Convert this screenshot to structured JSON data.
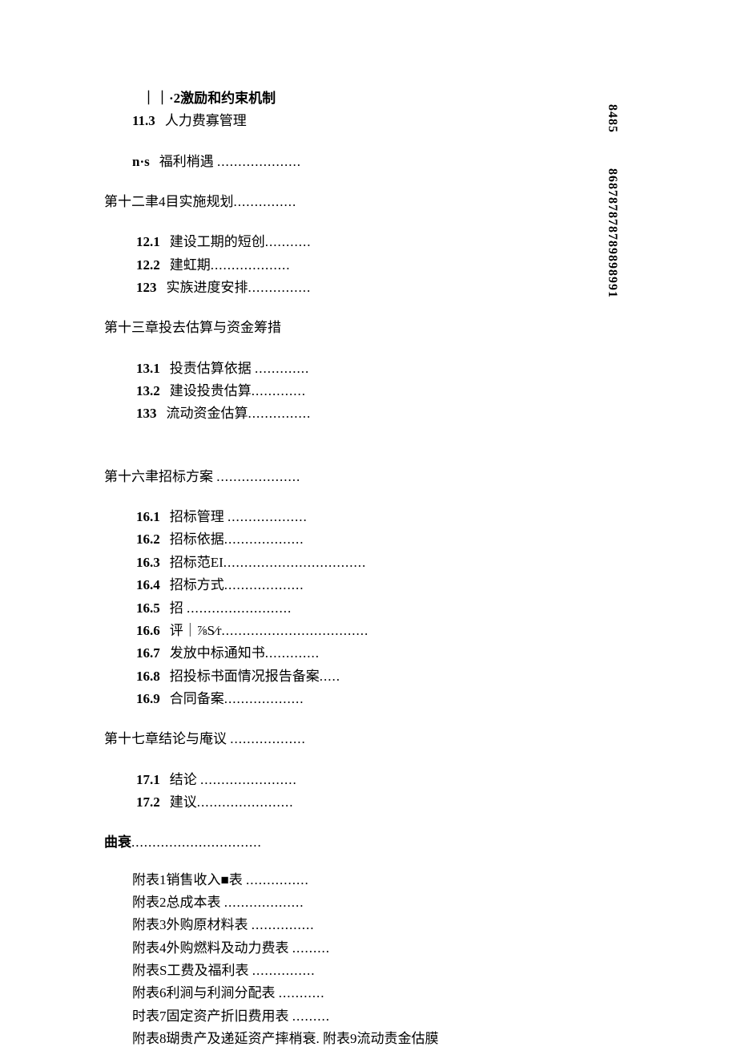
{
  "lines": [
    {
      "cls": "indent1 bold",
      "num": "",
      "label": "｜｜·2激励和约束机制",
      "dots": ""
    },
    {
      "cls": "indent1",
      "num": "11.3",
      "label": "人力费寡管理",
      "dots": ""
    },
    {
      "cls": "gap-md",
      "spacer": true
    },
    {
      "cls": "indent1",
      "num": "n·s",
      "label": "福利梢遇 ",
      "dots": "...................."
    },
    {
      "cls": "gap-md",
      "spacer": true
    },
    {
      "cls": "noNum",
      "num": "",
      "label": "第十二聿4目实施规划",
      "dots": "..............."
    },
    {
      "cls": "gap-md",
      "spacer": true
    },
    {
      "cls": "indent2",
      "num": "12.1",
      "label": "建设工期的短创",
      "dots": "..........."
    },
    {
      "cls": "indent2",
      "num": "12.2",
      "label": "建虹期",
      "dots": "..................."
    },
    {
      "cls": "indent2",
      "num": "123",
      "label": "实族进度安排",
      "dots": "..............."
    },
    {
      "cls": "gap-md",
      "spacer": true
    },
    {
      "cls": "noNum",
      "num": "",
      "label": "第十三章投去估算与资金筹措",
      "dots": ""
    },
    {
      "cls": "gap-md",
      "spacer": true
    },
    {
      "cls": "indent2",
      "num": "13.1",
      "label": "投责估算依据 ",
      "dots": "............."
    },
    {
      "cls": "indent2",
      "num": "13.2",
      "label": "建设投贵估算",
      "dots": "............."
    },
    {
      "cls": "indent2",
      "num": "133",
      "label": "流动资金估算",
      "dots": "..............."
    },
    {
      "cls": "gap-xl",
      "spacer": true
    },
    {
      "cls": "noNum",
      "num": "",
      "label": "第十六聿招标方案 ",
      "dots": "...................."
    },
    {
      "cls": "gap-md",
      "spacer": true
    },
    {
      "cls": "indent2",
      "num": "16.1",
      "label": "招标管理 ",
      "dots": "..................."
    },
    {
      "cls": "indent2",
      "num": "16.2",
      "label": "招标依据",
      "dots": "..................."
    },
    {
      "cls": "indent2",
      "num": "16.3",
      "label": "招标范EI",
      "dots": ".................................."
    },
    {
      "cls": "indent2",
      "num": "16.4",
      "label": "招标方式",
      "dots": "..................."
    },
    {
      "cls": "indent2",
      "num": "16.5",
      "label": "招 ",
      "dots": "........................."
    },
    {
      "cls": "indent2",
      "num": "16.6",
      "label": "评｜⅞S⁄r",
      "dots": "..................................."
    },
    {
      "cls": "indent2",
      "num": "16.7",
      "label": "发放中标通知书",
      "dots": "............."
    },
    {
      "cls": "indent2",
      "num": "16.8",
      "label": "招投标书面情况报告备案",
      "dots": "....."
    },
    {
      "cls": "indent2",
      "num": "16.9",
      "label": "合同备案",
      "dots": "..................."
    },
    {
      "cls": "gap-md",
      "spacer": true
    },
    {
      "cls": "noNum",
      "num": "",
      "label": "第十七章结论与庵议 ",
      "dots": ".................."
    },
    {
      "cls": "gap-md",
      "spacer": true
    },
    {
      "cls": "indent2",
      "num": "17.1",
      "label": "结论 ",
      "dots": "......................."
    },
    {
      "cls": "indent2",
      "num": "17.2",
      "label": "建议",
      "dots": "......................."
    },
    {
      "cls": "gap-md",
      "spacer": true
    },
    {
      "cls": "noNum bold",
      "num": "",
      "label": "曲衰",
      "dots": "..............................."
    },
    {
      "cls": "gap-sm",
      "spacer": true
    },
    {
      "cls": "indent1 noNum",
      "num": "",
      "label": "附表1销售收入■表 ",
      "dots": "..............."
    },
    {
      "cls": "indent1 noNum",
      "num": "",
      "label": "附表2总成本表 ",
      "dots": "..................."
    },
    {
      "cls": "indent1 noNum",
      "num": "",
      "label": "附表3外购原材料表 ",
      "dots": "..............."
    },
    {
      "cls": "indent1 noNum",
      "num": "",
      "label": "附表4外购燃料及动力费表 ",
      "dots": "........."
    },
    {
      "cls": "indent1 noNum",
      "num": "",
      "label": "附表S工费及福利表 ",
      "dots": "..............."
    },
    {
      "cls": "indent1 noNum",
      "num": "",
      "label": "附表6利涧与利涧分配表 ",
      "dots": "..........."
    },
    {
      "cls": "indent1 noNum",
      "num": "",
      "label": "时表7固定资产折旧费用表 ",
      "dots": "........."
    },
    {
      "cls": "indent1 noNum",
      "num": "",
      "label": "附表8瑚贵产及递延资产摔梢衰. 附表9流动责金估膜",
      "dots": ""
    }
  ],
  "side1": "8485",
  "side2": "868787878789898991"
}
